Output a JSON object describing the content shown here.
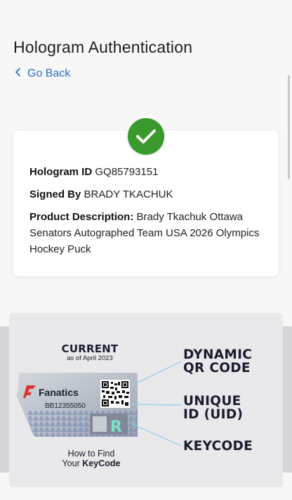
{
  "header": {
    "title": "Hologram Authentication",
    "back_label": "Go Back"
  },
  "card": {
    "hologram_id_label": "Hologram ID",
    "hologram_id_value": "GQ85793151",
    "signed_by_label": "Signed By",
    "signed_by_value": "BRADY TKACHUK",
    "product_label": "Product Description:",
    "product_value": "Brady Tkachuk Ottawa Senators Autographed Team USA 2026 Olympics Hockey Puck"
  },
  "graphic": {
    "current": "CURRENT",
    "as_of": "as of April 2023",
    "brand": "Fanatics",
    "serial": "BB12355050",
    "r_letter": "R",
    "label_qr_line1": "DYNAMIC",
    "label_qr_line2": "QR CODE",
    "label_uid_line1": "UNIQUE",
    "label_uid_line2": "ID (UID)",
    "label_keycode": "KEYCODE",
    "howto_line1": "How to Find",
    "howto_your": "Your",
    "howto_keycode": "KeyCode"
  },
  "colors": {
    "accent_link": "#2f6fc7",
    "success_green": "#3a9a2e",
    "fanatics_red": "#e0312f"
  }
}
